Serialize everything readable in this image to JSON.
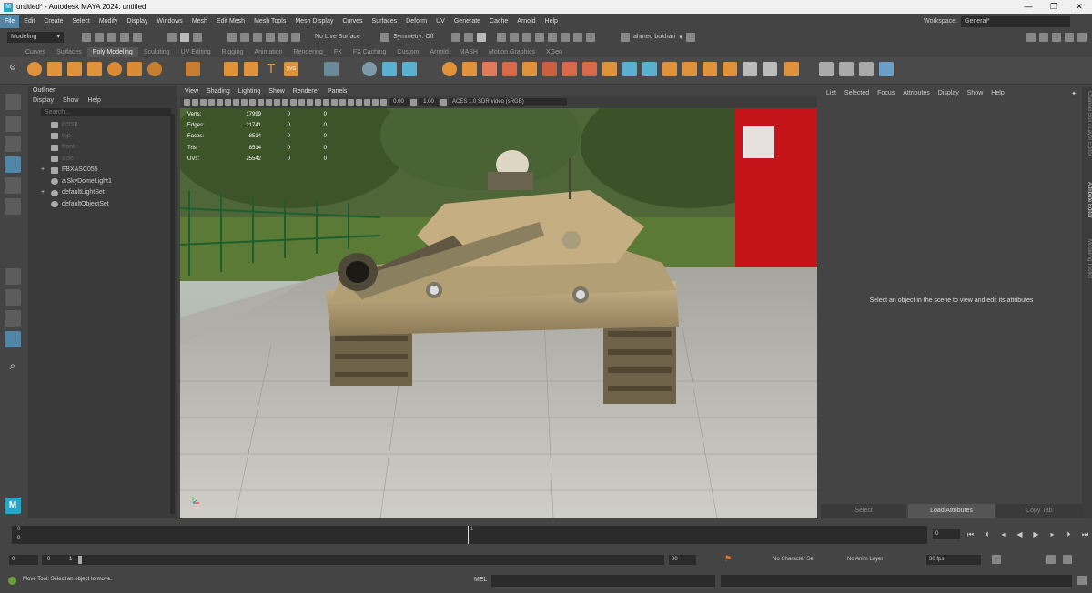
{
  "window": {
    "title": "untitled* - Autodesk MAYA 2024: untitled",
    "controls": [
      "—",
      "❐",
      "✕"
    ]
  },
  "menu": {
    "items": [
      "File",
      "Edit",
      "Create",
      "Select",
      "Modify",
      "Display",
      "Windows",
      "Mesh",
      "Edit Mesh",
      "Mesh Tools",
      "Mesh Display",
      "Curves",
      "Surfaces",
      "Deform",
      "UV",
      "Generate",
      "Cache",
      "Arnold",
      "Help"
    ],
    "workspace_label": "Workspace:",
    "workspace_value": "General*"
  },
  "statusline": {
    "mode": "Modeling",
    "live_surface": "No Live Surface",
    "symmetry": "Symmetry: Off",
    "user": "ahmed bukhari"
  },
  "shelf": {
    "tabs": [
      "Curves",
      "Surfaces",
      "Poly Modeling",
      "Sculpting",
      "UV Editing",
      "Rigging",
      "Animation",
      "Rendering",
      "FX",
      "FX Caching",
      "Custom",
      "Arnold",
      "MASH",
      "Motion Graphics",
      "XGen"
    ],
    "active_tab": "Poly Modeling"
  },
  "outliner": {
    "title": "Outliner",
    "menu": [
      "Display",
      "Show",
      "Help"
    ],
    "search_placeholder": "Search...",
    "items": [
      {
        "label": "persp",
        "dim": true,
        "expand": ""
      },
      {
        "label": "top",
        "dim": true,
        "expand": ""
      },
      {
        "label": "front",
        "dim": true,
        "expand": ""
      },
      {
        "label": "side",
        "dim": true,
        "expand": ""
      },
      {
        "label": "FBXASC055",
        "dim": false,
        "expand": "+"
      },
      {
        "label": "aiSkyDomeLight1",
        "dim": false,
        "expand": ""
      },
      {
        "label": "defaultLightSet",
        "dim": false,
        "expand": "+"
      },
      {
        "label": "defaultObjectSet",
        "dim": false,
        "expand": ""
      }
    ]
  },
  "viewport": {
    "menu": [
      "View",
      "Shading",
      "Lighting",
      "Show",
      "Renderer",
      "Panels"
    ],
    "exposure": "0.00",
    "gamma": "1.00",
    "color_space": "ACES 1.0 SDR-video (sRGB)",
    "hud": [
      {
        "label": "Verts:",
        "v1": "17999",
        "v2": "0",
        "v3": "0"
      },
      {
        "label": "Edges:",
        "v1": "21741",
        "v2": "0",
        "v3": "0"
      },
      {
        "label": "Faces:",
        "v1": "8514",
        "v2": "0",
        "v3": "0"
      },
      {
        "label": "Tris:",
        "v1": "8514",
        "v2": "0",
        "v3": "0"
      },
      {
        "label": "UVs:",
        "v1": "25542",
        "v2": "0",
        "v3": "0"
      }
    ]
  },
  "attribute_editor": {
    "menu": [
      "List",
      "Selected",
      "Focus",
      "Attributes",
      "Display",
      "Show",
      "Help"
    ],
    "message": "Select an object in the scene to view and edit its attributes",
    "buttons": [
      "Select",
      "Load Attributes",
      "Copy Tab"
    ],
    "side_tabs": [
      "Channel Box / Layer Editor",
      "Attribute Editor",
      "Modeling Toolkit"
    ]
  },
  "timeline": {
    "start": "0",
    "start2": "0",
    "current_marker": "1",
    "current_frame": "0"
  },
  "range": {
    "start": "0",
    "inner_start": "0",
    "inner_end": "1",
    "end": "30",
    "character_set": "No Character Set",
    "anim_layer": "No Anim Layer",
    "fps": "30 fps"
  },
  "command": {
    "help": "Move Tool: Select an object to move.",
    "mel": "MEL"
  },
  "colors": {
    "accent": "#5285a6",
    "bg": "#444444",
    "panel": "#3a3a3a"
  }
}
